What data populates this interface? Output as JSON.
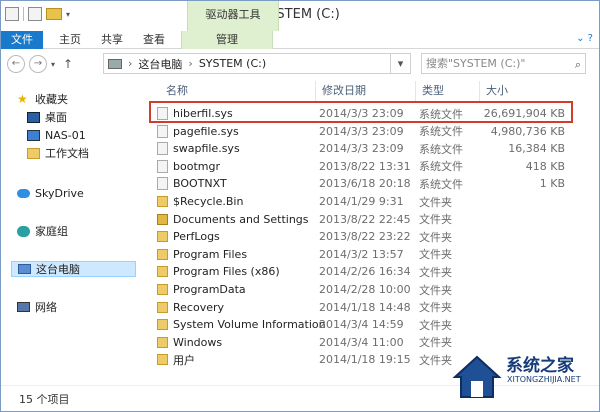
{
  "window": {
    "title": "SYSTEM (C:)",
    "contextual_tab": "驱动器工具"
  },
  "ribbon": {
    "tabs": [
      "文件",
      "主页",
      "共享",
      "查看"
    ],
    "manage": "管理"
  },
  "address": {
    "parts": [
      "这台电脑",
      "SYSTEM (C:)"
    ],
    "search_placeholder": "搜索\"SYSTEM (C:)\""
  },
  "nav": {
    "items": [
      {
        "label": "收藏夹",
        "icon": "star-icon"
      },
      {
        "label": "桌面",
        "icon": "desktop-icon"
      },
      {
        "label": "NAS-01",
        "icon": "computer-icon"
      },
      {
        "label": "工作文档",
        "icon": "folder-icon"
      },
      {
        "label": "SkyDrive",
        "icon": "cloud-icon"
      },
      {
        "label": "家庭组",
        "icon": "homegroup-icon"
      },
      {
        "label": "这台电脑",
        "icon": "pc-icon"
      },
      {
        "label": "网络",
        "icon": "network-icon"
      }
    ]
  },
  "list": {
    "headers": [
      "名称",
      "修改日期",
      "类型",
      "大小"
    ],
    "rows": [
      {
        "name": "hiberfil.sys",
        "date": "2014/3/3 23:09",
        "type": "系统文件",
        "size": "26,691,904 KB",
        "icon": "sys"
      },
      {
        "name": "pagefile.sys",
        "date": "2014/3/3 23:09",
        "type": "系统文件",
        "size": "4,980,736 KB",
        "icon": "sys"
      },
      {
        "name": "swapfile.sys",
        "date": "2014/3/3 23:09",
        "type": "系统文件",
        "size": "16,384 KB",
        "icon": "sys"
      },
      {
        "name": "bootmgr",
        "date": "2013/8/22 13:31",
        "type": "系统文件",
        "size": "418 KB",
        "icon": "sys"
      },
      {
        "name": "BOOTNXT",
        "date": "2013/6/18 20:18",
        "type": "系统文件",
        "size": "1 KB",
        "icon": "sys"
      },
      {
        "name": "$Recycle.Bin",
        "date": "2014/1/29 9:31",
        "type": "文件夹",
        "size": "",
        "icon": "fold"
      },
      {
        "name": "Documents and Settings",
        "date": "2013/8/22 22:45",
        "type": "文件夹",
        "size": "",
        "icon": "lnk"
      },
      {
        "name": "PerfLogs",
        "date": "2013/8/22 23:22",
        "type": "文件夹",
        "size": "",
        "icon": "fold"
      },
      {
        "name": "Program Files",
        "date": "2014/3/2 13:57",
        "type": "文件夹",
        "size": "",
        "icon": "fold"
      },
      {
        "name": "Program Files (x86)",
        "date": "2014/2/26 16:34",
        "type": "文件夹",
        "size": "",
        "icon": "fold"
      },
      {
        "name": "ProgramData",
        "date": "2014/2/28 10:00",
        "type": "文件夹",
        "size": "",
        "icon": "fold"
      },
      {
        "name": "Recovery",
        "date": "2014/1/18 14:48",
        "type": "文件夹",
        "size": "",
        "icon": "fold"
      },
      {
        "name": "System Volume Information",
        "date": "2014/3/4 14:59",
        "type": "文件夹",
        "size": "",
        "icon": "fold"
      },
      {
        "name": "Windows",
        "date": "2014/3/4 11:00",
        "type": "文件夹",
        "size": "",
        "icon": "fold"
      },
      {
        "name": "用户",
        "date": "2014/1/18 19:15",
        "type": "文件夹",
        "size": "",
        "icon": "fold"
      }
    ]
  },
  "status": {
    "count": "15 个项目"
  },
  "watermark": {
    "text": "系统之家",
    "url": "XITONGZHIJIA.NET"
  }
}
